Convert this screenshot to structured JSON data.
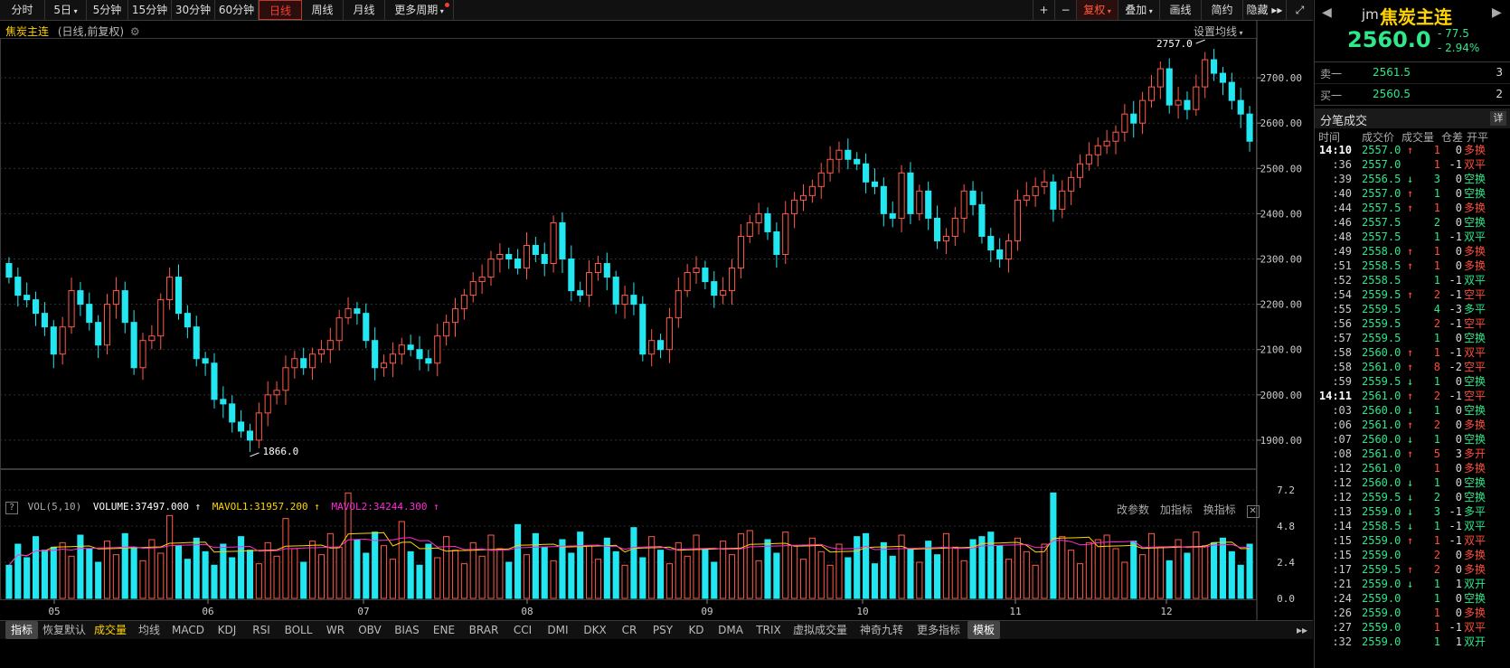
{
  "toolbar": {
    "periods": [
      "分时",
      "5日",
      "5分钟",
      "15分钟",
      "30分钟",
      "60分钟",
      "日线",
      "周线",
      "月线",
      "更多周期"
    ],
    "active_period": "日线",
    "right_buttons": [
      "+",
      "−",
      "复权",
      "叠加",
      "画线",
      "简约",
      "隐藏"
    ],
    "active_right": "复权"
  },
  "chart": {
    "symbol": "焦炭主连",
    "subtitle": "(日线,前复权)",
    "ma_setting": "设置均线",
    "high_label": "2757.0",
    "low_label": "1866.0",
    "y_ticks": [
      "2700.00",
      "2600.00",
      "2500.00",
      "2400.00",
      "2300.00",
      "2200.00",
      "2100.00",
      "2000.00",
      "1900.00"
    ],
    "x_ticks": [
      "05",
      "06",
      "07",
      "08",
      "09",
      "10",
      "11",
      "12"
    ]
  },
  "volume": {
    "title": "VOL(5,10)",
    "volume_text": "VOLUME:37497.000",
    "mavol1_text": "MAVOL1:31957.200",
    "mavol2_text": "MAVOL2:34244.300",
    "actions": [
      "改参数",
      "加指标",
      "换指标"
    ],
    "y_ticks": [
      "7.2",
      "4.8",
      "2.4",
      "0.0"
    ]
  },
  "indicators": {
    "items": [
      "指标",
      "恢复默认",
      "成交量",
      "均线",
      "MACD",
      "KDJ",
      "RSI",
      "BOLL",
      "WR",
      "OBV",
      "BIAS",
      "ENE",
      "BRAR",
      "CCI",
      "DMI",
      "DKX",
      "CR",
      "PSY",
      "KD",
      "DMA",
      "TRIX",
      "虚拟成交量",
      "神奇九转",
      "更多指标",
      "模板"
    ],
    "active": "成交量"
  },
  "quote": {
    "code": "jm",
    "name": "焦炭主连",
    "price": "2560.0",
    "change": "- 77.5",
    "change_pct": "- 2.94%",
    "ask_label": "卖一",
    "ask_price": "2561.5",
    "ask_qty": "3",
    "bid_label": "买一",
    "bid_price": "2560.5",
    "bid_qty": "2",
    "ticks_title": "分笔成交",
    "detail_btn": "详",
    "tick_headers": [
      "时间",
      "成交价",
      "成交量",
      "仓差",
      "开平"
    ]
  },
  "ticks": [
    {
      "t": "14:10",
      "p": "2557.0",
      "d": "up",
      "q": "1",
      "oi": "0",
      "k": "多换",
      "kd": "up"
    },
    {
      "t": ":36",
      "p": "2557.0",
      "d": "",
      "q": "1",
      "oi": "-1",
      "k": "双平",
      "kd": "up"
    },
    {
      "t": ":39",
      "p": "2556.5",
      "d": "down",
      "q": "3",
      "oi": "0",
      "k": "空换",
      "kd": "down"
    },
    {
      "t": ":40",
      "p": "2557.0",
      "d": "up",
      "q": "1",
      "oi": "0",
      "k": "空换",
      "kd": "down"
    },
    {
      "t": ":44",
      "p": "2557.5",
      "d": "up",
      "q": "1",
      "oi": "0",
      "k": "多换",
      "kd": "up"
    },
    {
      "t": ":46",
      "p": "2557.5",
      "d": "",
      "q": "2",
      "oi": "0",
      "k": "空换",
      "kd": "down"
    },
    {
      "t": ":48",
      "p": "2557.5",
      "d": "",
      "q": "1",
      "oi": "-1",
      "k": "双平",
      "kd": "down"
    },
    {
      "t": ":49",
      "p": "2558.0",
      "d": "up",
      "q": "1",
      "oi": "0",
      "k": "多换",
      "kd": "up"
    },
    {
      "t": ":51",
      "p": "2558.5",
      "d": "up",
      "q": "1",
      "oi": "0",
      "k": "多换",
      "kd": "up"
    },
    {
      "t": ":52",
      "p": "2558.5",
      "d": "",
      "q": "1",
      "oi": "-1",
      "k": "双平",
      "kd": "down"
    },
    {
      "t": ":54",
      "p": "2559.5",
      "d": "up",
      "q": "2",
      "oi": "-1",
      "k": "空平",
      "kd": "up"
    },
    {
      "t": ":55",
      "p": "2559.5",
      "d": "",
      "q": "4",
      "oi": "-3",
      "k": "多平",
      "kd": "down"
    },
    {
      "t": ":56",
      "p": "2559.5",
      "d": "",
      "q": "2",
      "oi": "-1",
      "k": "空平",
      "kd": "up"
    },
    {
      "t": ":57",
      "p": "2559.5",
      "d": "",
      "q": "1",
      "oi": "0",
      "k": "空换",
      "kd": "down"
    },
    {
      "t": ":58",
      "p": "2560.0",
      "d": "up",
      "q": "1",
      "oi": "-1",
      "k": "双平",
      "kd": "up"
    },
    {
      "t": ":58",
      "p": "2561.0",
      "d": "up",
      "q": "8",
      "oi": "-2",
      "k": "空平",
      "kd": "up"
    },
    {
      "t": ":59",
      "p": "2559.5",
      "d": "down",
      "q": "1",
      "oi": "0",
      "k": "空换",
      "kd": "down"
    },
    {
      "t": "14:11",
      "p": "2561.0",
      "d": "up",
      "q": "2",
      "oi": "-1",
      "k": "空平",
      "kd": "up"
    },
    {
      "t": ":03",
      "p": "2560.0",
      "d": "down",
      "q": "1",
      "oi": "0",
      "k": "空换",
      "kd": "down"
    },
    {
      "t": ":06",
      "p": "2561.0",
      "d": "up",
      "q": "2",
      "oi": "0",
      "k": "多换",
      "kd": "up"
    },
    {
      "t": ":07",
      "p": "2560.0",
      "d": "down",
      "q": "1",
      "oi": "0",
      "k": "空换",
      "kd": "down"
    },
    {
      "t": ":08",
      "p": "2561.0",
      "d": "up",
      "q": "5",
      "oi": "3",
      "k": "多开",
      "kd": "up"
    },
    {
      "t": ":12",
      "p": "2561.0",
      "d": "",
      "q": "1",
      "oi": "0",
      "k": "多换",
      "kd": "up"
    },
    {
      "t": ":12",
      "p": "2560.0",
      "d": "down",
      "q": "1",
      "oi": "0",
      "k": "空换",
      "kd": "down"
    },
    {
      "t": ":12",
      "p": "2559.5",
      "d": "down",
      "q": "2",
      "oi": "0",
      "k": "空换",
      "kd": "down"
    },
    {
      "t": ":13",
      "p": "2559.0",
      "d": "down",
      "q": "3",
      "oi": "-1",
      "k": "多平",
      "kd": "down"
    },
    {
      "t": ":14",
      "p": "2558.5",
      "d": "down",
      "q": "1",
      "oi": "-1",
      "k": "双平",
      "kd": "down"
    },
    {
      "t": ":15",
      "p": "2559.0",
      "d": "up",
      "q": "1",
      "oi": "-1",
      "k": "双平",
      "kd": "up"
    },
    {
      "t": ":15",
      "p": "2559.0",
      "d": "",
      "q": "2",
      "oi": "0",
      "k": "多换",
      "kd": "up"
    },
    {
      "t": ":17",
      "p": "2559.5",
      "d": "up",
      "q": "2",
      "oi": "0",
      "k": "多换",
      "kd": "up"
    },
    {
      "t": ":21",
      "p": "2559.0",
      "d": "down",
      "q": "1",
      "oi": "1",
      "k": "双开",
      "kd": "down"
    },
    {
      "t": ":24",
      "p": "2559.0",
      "d": "",
      "q": "1",
      "oi": "0",
      "k": "空换",
      "kd": "down"
    },
    {
      "t": ":26",
      "p": "2559.0",
      "d": "",
      "q": "1",
      "oi": "0",
      "k": "多换",
      "kd": "up"
    },
    {
      "t": ":27",
      "p": "2559.0",
      "d": "",
      "q": "1",
      "oi": "-1",
      "k": "双平",
      "kd": "up"
    },
    {
      "t": ":32",
      "p": "2559.0",
      "d": "",
      "q": "1",
      "oi": "1",
      "k": "双开",
      "kd": "down"
    }
  ],
  "chart_data": {
    "type": "candlestick",
    "y_range": [
      1840,
      2780
    ],
    "closes": [
      2260,
      2220,
      2210,
      2180,
      2150,
      2090,
      2150,
      2230,
      2200,
      2160,
      2110,
      2200,
      2230,
      2160,
      2060,
      2120,
      2130,
      2210,
      2260,
      2180,
      2150,
      2080,
      2070,
      1990,
      1980,
      1940,
      1920,
      1900,
      1960,
      2000,
      2010,
      2060,
      2080,
      2060,
      2090,
      2100,
      2120,
      2170,
      2190,
      2180,
      2120,
      2060,
      2070,
      2090,
      2110,
      2100,
      2080,
      2070,
      2130,
      2160,
      2190,
      2220,
      2250,
      2260,
      2300,
      2310,
      2300,
      2280,
      2330,
      2310,
      2290,
      2380,
      2300,
      2230,
      2220,
      2270,
      2290,
      2260,
      2200,
      2220,
      2200,
      2090,
      2120,
      2100,
      2170,
      2230,
      2270,
      2280,
      2250,
      2220,
      2230,
      2280,
      2350,
      2380,
      2400,
      2360,
      2310,
      2400,
      2430,
      2440,
      2460,
      2490,
      2520,
      2540,
      2520,
      2510,
      2470,
      2460,
      2400,
      2390,
      2490,
      2400,
      2450,
      2390,
      2340,
      2350,
      2390,
      2450,
      2420,
      2350,
      2320,
      2300,
      2340,
      2430,
      2440,
      2460,
      2470,
      2410,
      2450,
      2480,
      2510,
      2530,
      2550,
      2560,
      2580,
      2620,
      2600,
      2650,
      2680,
      2720,
      2640,
      2650,
      2630,
      2680,
      2740,
      2710,
      2690,
      2650,
      2620,
      2560
    ]
  }
}
